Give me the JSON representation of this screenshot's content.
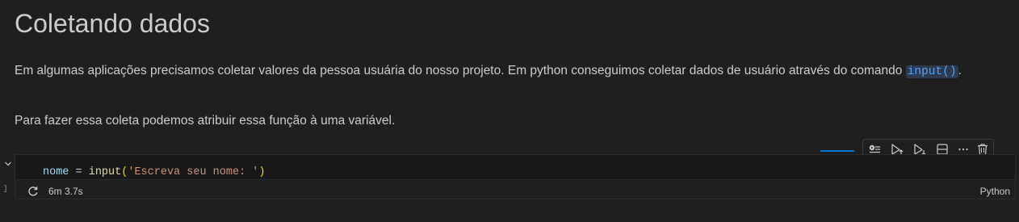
{
  "markdown": {
    "heading": "Coletando dados",
    "paragraph1_text": "Em algumas aplicações precisamos coletar valores da pessoa usuária do nosso projeto. Em python conseguimos coletar dados de usuário através do comando ",
    "paragraph1_code": "input()",
    "paragraph1_end": ".",
    "paragraph2": "Para fazer essa coleta podemos atribuir essa função à uma variável."
  },
  "code_cell": {
    "tokens": {
      "var": "nome",
      "op": " = ",
      "fn": "input",
      "open": "(",
      "str": "'Escreva seu nome: '",
      "close": ")"
    },
    "execution_time": "6m 3.7s",
    "language": "Python",
    "exec_bracket": "]"
  },
  "toolbar": {
    "icons": [
      "run-by-line-icon",
      "execute-above-icon",
      "execute-below-icon",
      "split-cell-icon",
      "more-actions-icon",
      "delete-cell-icon"
    ]
  },
  "colors": {
    "background": "#1f1f1f",
    "accent": "#0078d4",
    "inline_code": "#4da3ff"
  }
}
